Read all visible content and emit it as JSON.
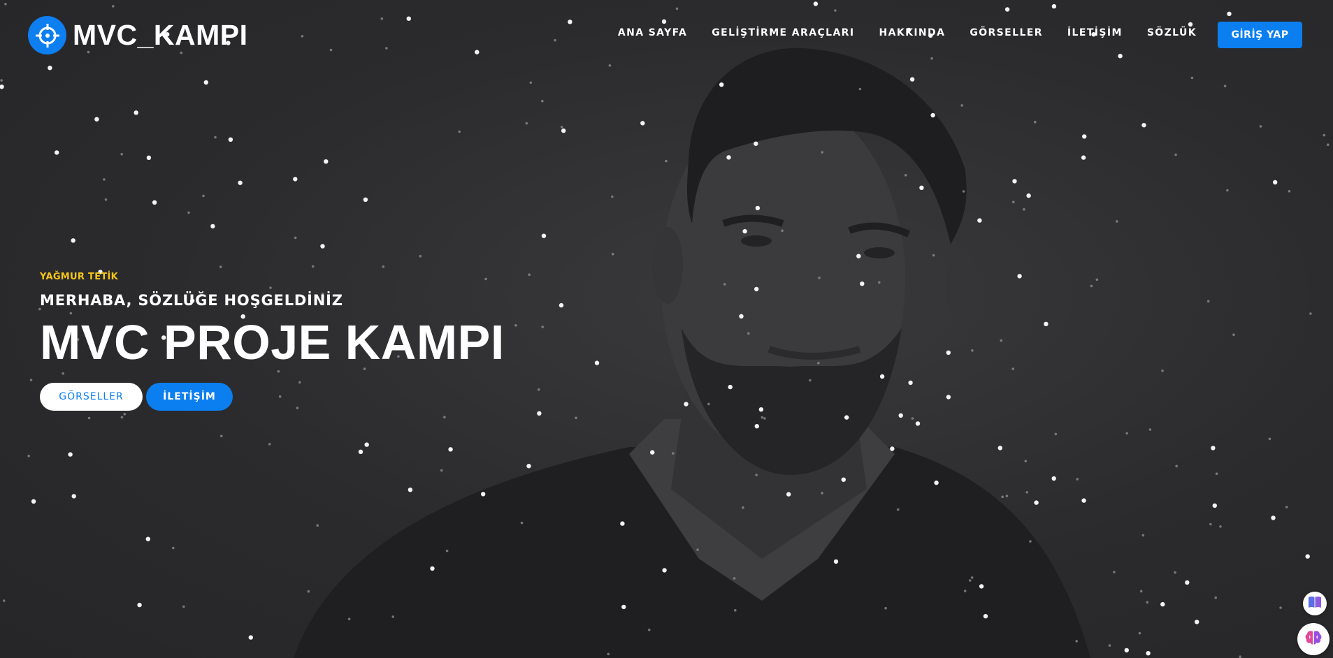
{
  "brand": {
    "name": "MVC_KAMPI",
    "icon": "crosshair-icon"
  },
  "nav": {
    "items": [
      "ANA SAYFA",
      "GELİŞTİRME ARAÇLARI",
      "HAKKINDA",
      "GÖRSELLER",
      "İLETİŞİM",
      "SÖZLÜK"
    ],
    "login_label": "GİRİŞ YAP"
  },
  "hero": {
    "eyebrow": "YAĞMUR TETİK",
    "subtitle": "MERHABA, SÖZLÜĞE HOŞGELDİNİZ",
    "title": "MVC PROJE KAMPI",
    "buttons": [
      "GÖRSELLER",
      "İLETİŞİM"
    ]
  },
  "widgets": {
    "book_icon": "book-icon",
    "brain_icon": "brain-icon"
  },
  "colors": {
    "accent": "#0b7ff0",
    "eyebrow": "#f5c518",
    "background": "#2c2c2e"
  }
}
